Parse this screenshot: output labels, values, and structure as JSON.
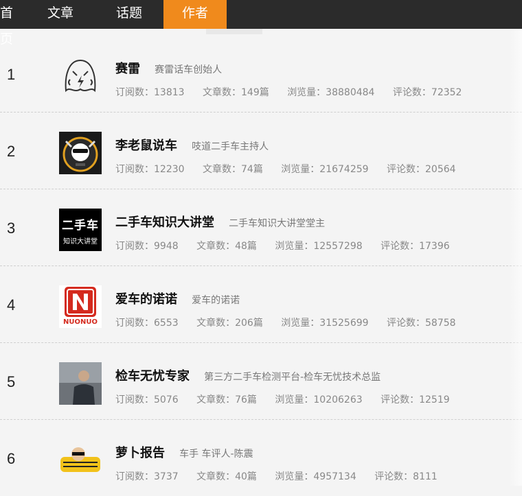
{
  "nav": {
    "tabs": [
      {
        "label": "首页"
      },
      {
        "label": "文章"
      },
      {
        "label": "话题"
      },
      {
        "label": "作者"
      }
    ]
  },
  "authors": [
    {
      "rank": "1",
      "name": "赛雷",
      "desc": "赛雷话车创始人",
      "subs": "订阅数：13813",
      "articles": "文章数：149篇",
      "views": "浏览量：38880484",
      "comments": "评论数：72352"
    },
    {
      "rank": "2",
      "name": "李老鼠说车",
      "desc": "吱道二手车主持人",
      "subs": "订阅数：12230",
      "articles": "文章数：74篇",
      "views": "浏览量：21674259",
      "comments": "评论数：20564"
    },
    {
      "rank": "3",
      "name": "二手车知识大讲堂",
      "desc": "二手车知识大讲堂堂主",
      "subs": "订阅数：9948",
      "articles": "文章数：48篇",
      "views": "浏览量：12557298",
      "comments": "评论数：17396",
      "logo_line1": "二手车",
      "logo_line2": "知识大讲堂"
    },
    {
      "rank": "4",
      "name": "爱车的诺诺",
      "desc": "爱车的诺诺",
      "subs": "订阅数：6553",
      "articles": "文章数：206篇",
      "views": "浏览量：31525699",
      "comments": "评论数：58758",
      "logo_text": "NUONUO"
    },
    {
      "rank": "5",
      "name": "检车无忧专家",
      "desc": "第三方二手车检测平台-检车无忧技术总监",
      "subs": "订阅数：5076",
      "articles": "文章数：76篇",
      "views": "浏览量：10206263",
      "comments": "评论数：12519"
    },
    {
      "rank": "6",
      "name": "萝卜报告",
      "desc": "车手 车评人-陈震",
      "subs": "订阅数：3737",
      "articles": "文章数：40篇",
      "views": "浏览量：4957134",
      "comments": "评论数：8111"
    }
  ],
  "colors": {
    "accent": "#f08a1c",
    "nav_bg": "#2b2b2b"
  }
}
